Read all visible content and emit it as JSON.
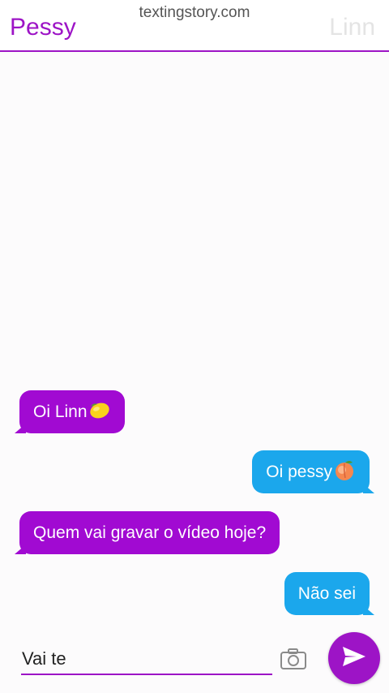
{
  "header": {
    "left_name": "Pessy",
    "right_name": "Linn",
    "watermark": "textingstory.com"
  },
  "messages": [
    {
      "side": "left",
      "text": "Oi Linn",
      "emoji": "lemon-icon"
    },
    {
      "side": "right",
      "text": "Oi pessy",
      "emoji": "peach-icon"
    },
    {
      "side": "left",
      "text": "Quem vai gravar o vídeo hoje?"
    },
    {
      "side": "right",
      "text": "Não sei"
    }
  ],
  "composer": {
    "value": "Vai te",
    "camera_icon": "camera-icon",
    "send_icon": "send-icon"
  },
  "colors": {
    "left_bubble": "#a10ad2",
    "right_bubble": "#1ba7ec",
    "accent": "#9d14c6"
  }
}
